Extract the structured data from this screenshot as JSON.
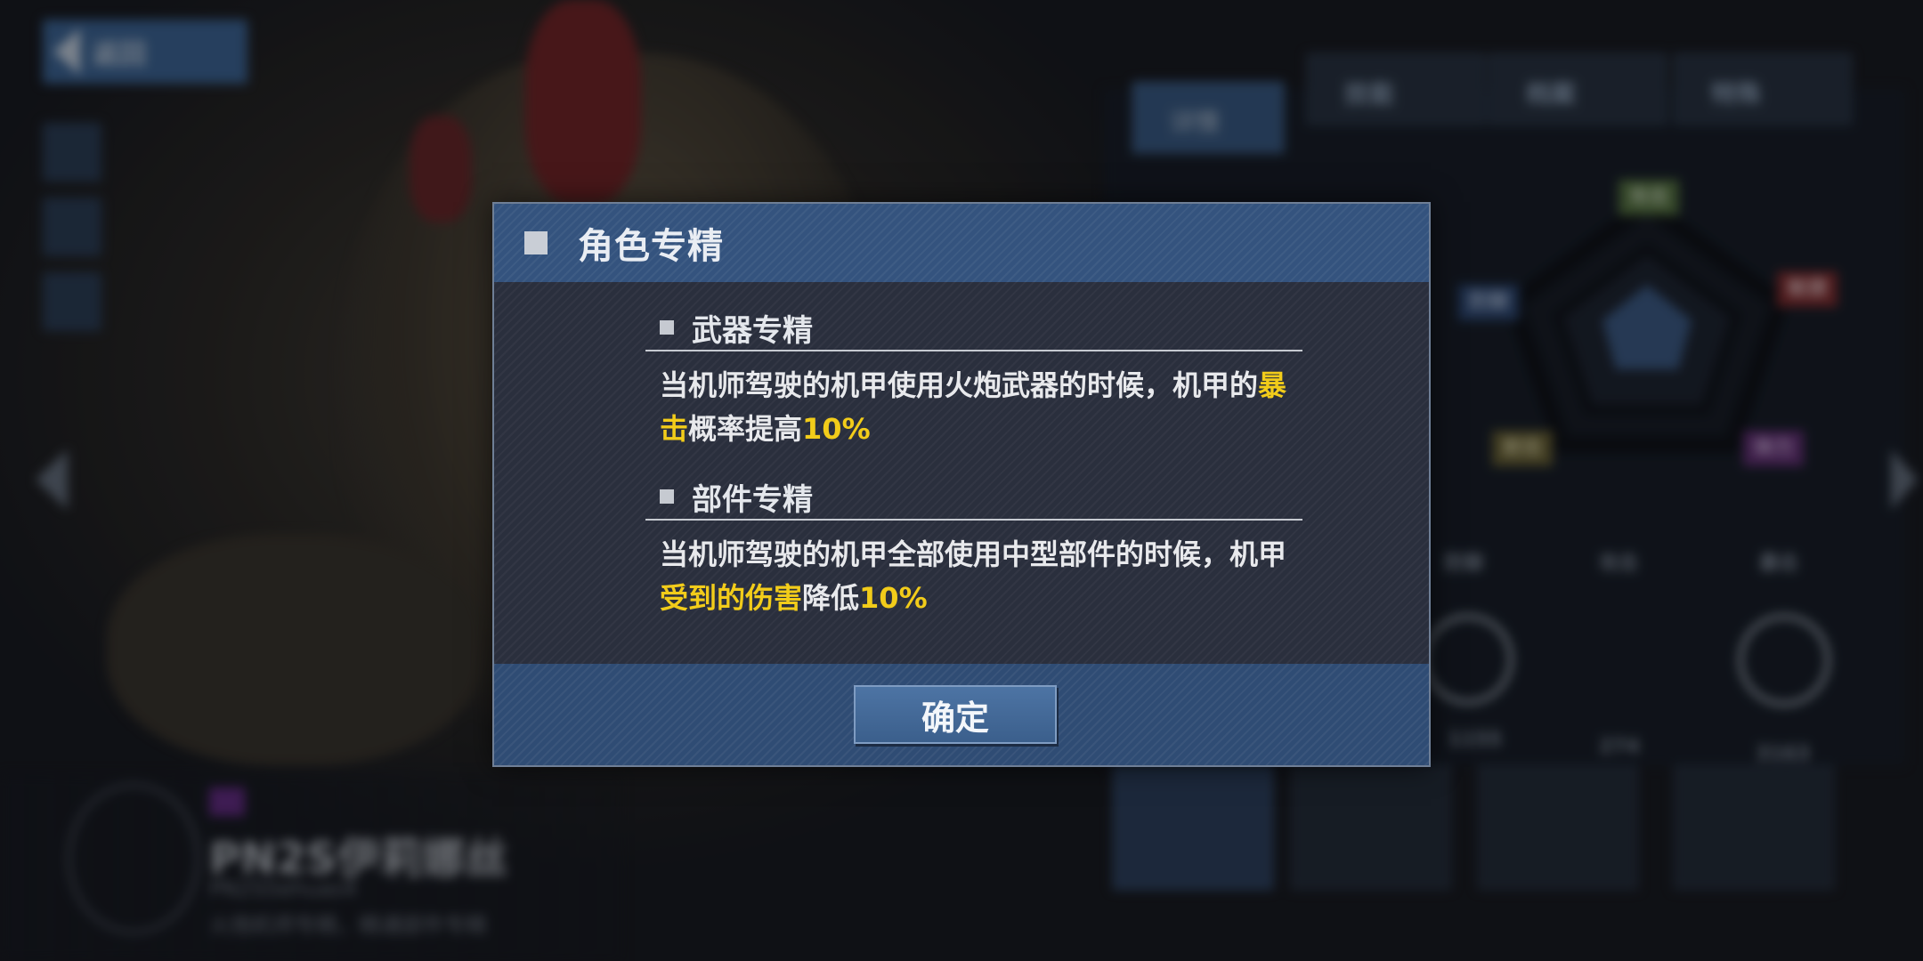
{
  "background": {
    "back_button_label": "返回",
    "top_tabs": [
      "详情",
      "技能",
      "档案",
      "特殊"
    ],
    "radar_tags": [
      "攻击",
      "防御",
      "敏捷",
      "射击",
      "体力"
    ],
    "stat_labels": [
      "防御",
      "攻击",
      "暴击"
    ],
    "stat_values": [
      "1155",
      "274",
      "3163"
    ],
    "character": {
      "name": "PN2S伊莉娜丝",
      "subtitle": "PN2S5ehuas4",
      "description": "火炮机师专精，精通部件专精"
    },
    "colors": {
      "accent_blue": "#3e6a9e",
      "highlight_yellow": "#f2cc1a"
    }
  },
  "modal": {
    "title": "角色专精",
    "sections": [
      {
        "heading": "武器专精",
        "line1_prefix": "当机师驾驶的机甲使用火炮武器的时候，机甲的",
        "line1_highlight": "暴",
        "line2_highlight": "击",
        "line2_text": "概率提高",
        "line2_value": "10%"
      },
      {
        "heading": "部件专精",
        "line1_text": "当机师驾驶的机甲全部使用中型部件的时候，机甲",
        "line2_highlight": "受到的伤害",
        "line2_text": "降低",
        "line2_value": "10%"
      }
    ],
    "confirm_label": "确定"
  }
}
